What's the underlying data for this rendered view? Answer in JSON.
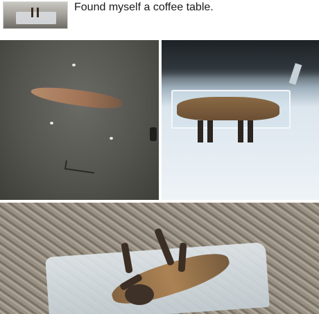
{
  "post": {
    "caption": "Found myself a coffee table."
  },
  "panels": [
    {
      "id": "murky-water-photo"
    },
    {
      "id": "snow-ice-animal-photo"
    },
    {
      "id": "upside-down-animal-ice-photo"
    }
  ]
}
